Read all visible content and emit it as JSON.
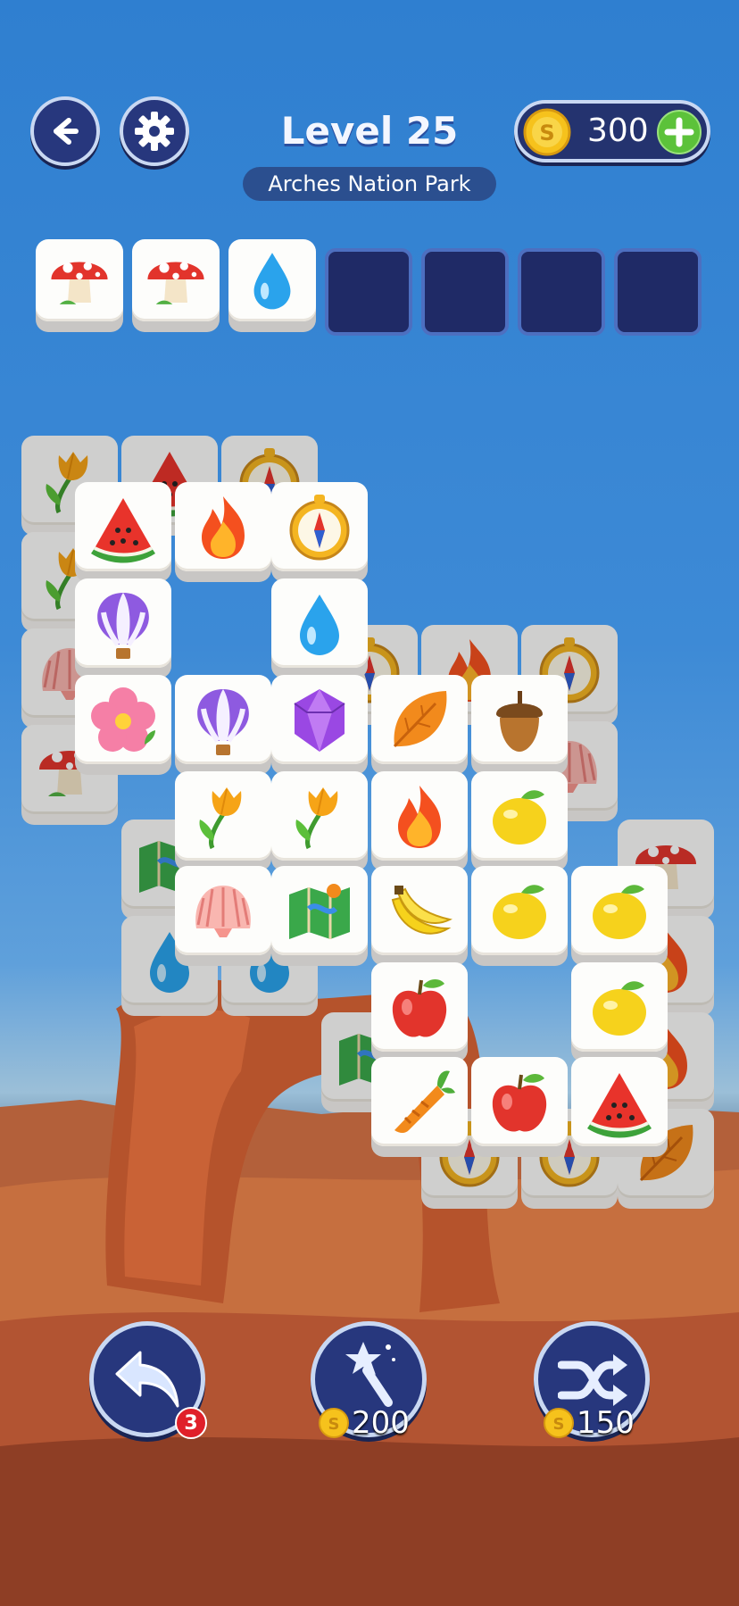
{
  "header": {
    "level_title": "Level 25",
    "location": "Arches Nation Park",
    "coins": "300",
    "back_icon": "back-arrow-icon",
    "settings_icon": "gear-icon",
    "add_coins_icon": "plus-icon"
  },
  "tray": {
    "capacity": 7,
    "filled": [
      "mushroom",
      "mushroom",
      "water-drop"
    ]
  },
  "board": {
    "tiles_visible": [
      "tulip",
      "watermelon",
      "compass",
      "watermelon",
      "fire",
      "compass",
      "balloon",
      "water-drop",
      "flower",
      "balloon",
      "gem",
      "leaf",
      "acorn",
      "tulip",
      "tulip",
      "fire",
      "lemon",
      "shell",
      "map",
      "banana",
      "lemon",
      "lemon",
      "apple",
      "lemon",
      "carrot",
      "apple",
      "watermelon",
      "mushroom",
      "shell",
      "fire",
      "compass"
    ]
  },
  "boosters": {
    "undo": {
      "icon": "undo-icon",
      "badge": "3"
    },
    "magic": {
      "icon": "magic-wand-icon",
      "price": "200"
    },
    "shuffle": {
      "icon": "shuffle-icon",
      "price": "150"
    }
  },
  "colors": {
    "button_fill": "#27377d",
    "button_border": "#c9d8f2",
    "coin": "#f6c21c",
    "plus": "#5cc23a"
  }
}
